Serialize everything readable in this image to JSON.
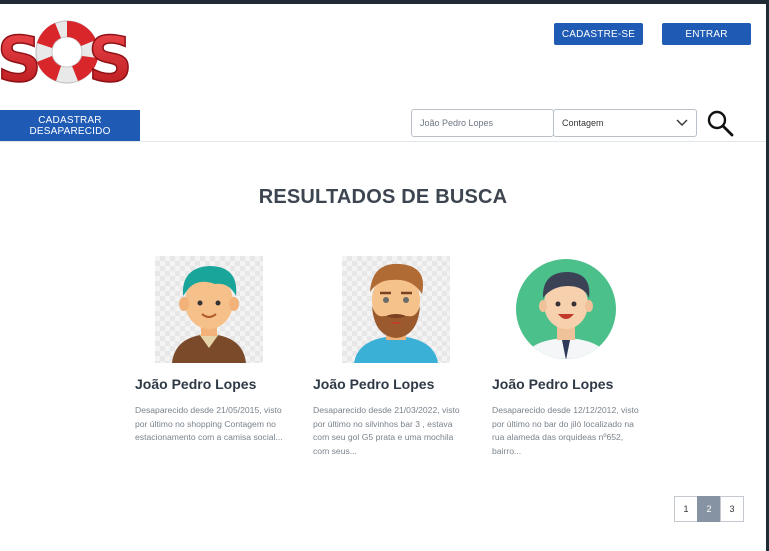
{
  "brand": {
    "logo_text": "SOS"
  },
  "header": {
    "signup_label": "CADASTRE-SE",
    "login_label": "ENTRAR"
  },
  "toolbar": {
    "register_missing_label": "CADASTRAR DESAPARECIDO",
    "search": {
      "placeholder": "João Pedro Lopes"
    },
    "city_select": {
      "selected": "Contagem"
    }
  },
  "main": {
    "title": "RESULTADOS DE BUSCA",
    "results": [
      {
        "name": "João Pedro Lopes",
        "description": "Desaparecido desde 21/05/2015, visto por último no shopping Contagem no estacionamento com a camisa social..."
      },
      {
        "name": "João Pedro Lopes",
        "description": "Desaparecido desde 21/03/2022, visto por último no silvinhos bar 3 , estava com seu gol G5 prata e uma mochila com seus..."
      },
      {
        "name": "João Pedro Lopes",
        "description": "Desaparecido desde 12/12/2012, visto por último no bar do jiló localizado na rua alameda das orquideas nº652, bairro..."
      }
    ],
    "pagination": {
      "pages": [
        "1",
        "2",
        "3"
      ],
      "current": "2"
    }
  },
  "colors": {
    "primary": "#1f5bb5",
    "logo_red": "#d8262b",
    "page_active": "#8593a3"
  }
}
